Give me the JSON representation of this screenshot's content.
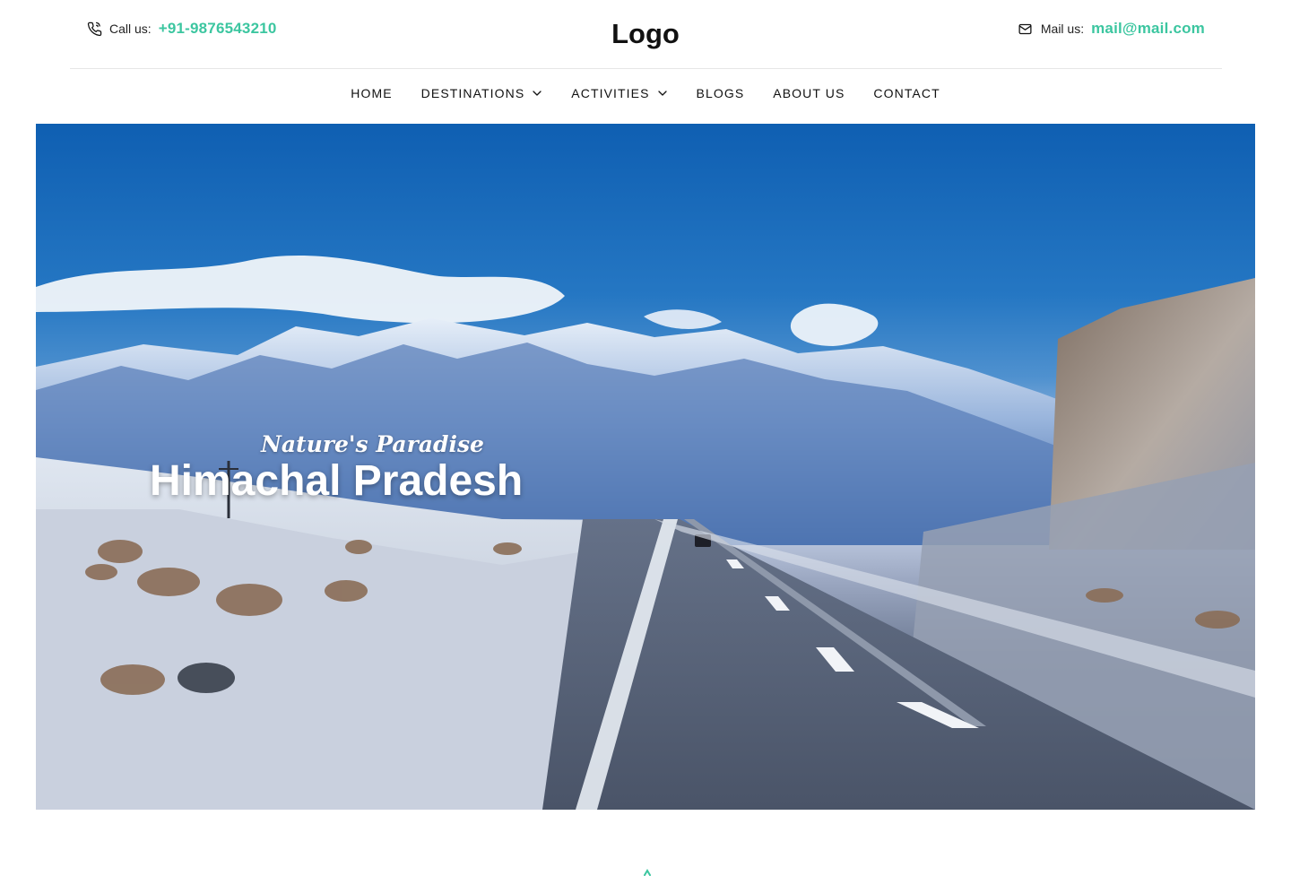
{
  "header": {
    "call_label": "Call us:",
    "call_value": "+91-9876543210",
    "logo": "Logo",
    "mail_label": "Mail us:",
    "mail_value": "mail@mail.com",
    "accent_color": "#3cc6a0"
  },
  "nav": {
    "items": [
      {
        "label": "HOME",
        "has_dropdown": false
      },
      {
        "label": "DESTINATIONS",
        "has_dropdown": true
      },
      {
        "label": "ACTIVITIES",
        "has_dropdown": true
      },
      {
        "label": "BLOGS",
        "has_dropdown": false
      },
      {
        "label": "ABOUT US",
        "has_dropdown": false
      },
      {
        "label": "CONTACT",
        "has_dropdown": false
      }
    ]
  },
  "hero": {
    "subtitle": "Nature's Paradise",
    "title": "Himachal Pradesh"
  },
  "icons": {
    "phone": "phone-icon",
    "mail": "mail-icon",
    "chevron": "chevron-down-icon"
  }
}
